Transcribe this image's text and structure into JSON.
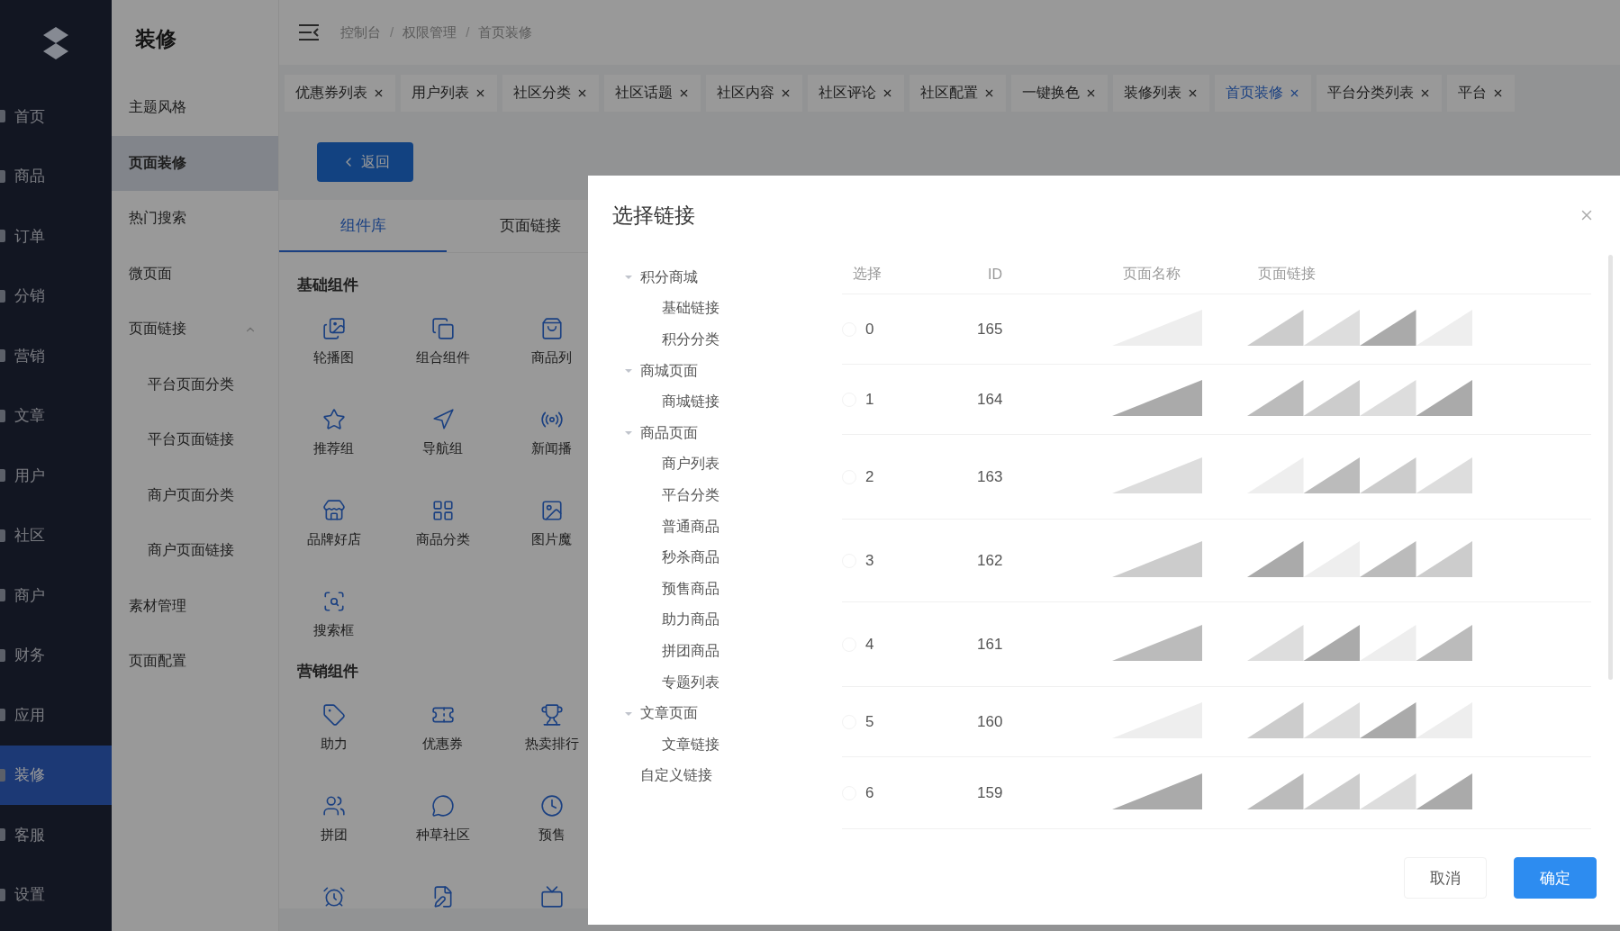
{
  "main_menu": [
    {
      "label": "首页",
      "selected": false
    },
    {
      "label": "商品",
      "selected": false
    },
    {
      "label": "订单",
      "selected": false
    },
    {
      "label": "分销",
      "selected": false
    },
    {
      "label": "营销",
      "selected": false
    },
    {
      "label": "文章",
      "selected": false
    },
    {
      "label": "用户",
      "selected": false
    },
    {
      "label": "社区",
      "selected": false
    },
    {
      "label": "商户",
      "selected": false
    },
    {
      "label": "财务",
      "selected": false
    },
    {
      "label": "应用",
      "selected": false
    },
    {
      "label": "装修",
      "selected": true
    },
    {
      "label": "客服",
      "selected": false
    },
    {
      "label": "设置",
      "selected": false
    }
  ],
  "sub_menu": {
    "title": "装修",
    "items": [
      {
        "label": "主题风格",
        "selected": false
      },
      {
        "label": "页面装修",
        "selected": true
      },
      {
        "label": "热门搜索",
        "selected": false
      },
      {
        "label": "微页面",
        "selected": false
      },
      {
        "label": "页面链接",
        "selected": false,
        "expanded": true,
        "children": [
          {
            "label": "平台页面分类",
            "selected": false
          },
          {
            "label": "平台页面链接",
            "selected": false
          },
          {
            "label": "商户页面分类",
            "selected": false
          },
          {
            "label": "商户页面链接",
            "selected": false
          }
        ]
      },
      {
        "label": "素材管理",
        "selected": false
      },
      {
        "label": "页面配置",
        "selected": false
      }
    ]
  },
  "breadcrumb": [
    "控制台",
    "权限管理",
    "首页装修"
  ],
  "breadcrumb_separator": "/",
  "page_tabs": [
    {
      "label": "优惠券列表",
      "selected": false
    },
    {
      "label": "用户列表",
      "selected": false
    },
    {
      "label": "社区分类",
      "selected": false
    },
    {
      "label": "社区话题",
      "selected": false
    },
    {
      "label": "社区内容",
      "selected": false
    },
    {
      "label": "社区评论",
      "selected": false
    },
    {
      "label": "社区配置",
      "selected": false
    },
    {
      "label": "一键换色",
      "selected": false
    },
    {
      "label": "装修列表",
      "selected": false
    },
    {
      "label": "首页装修",
      "selected": true
    },
    {
      "label": "平台分类列表",
      "selected": false
    },
    {
      "label": "平台",
      "selected": false
    }
  ],
  "back_button": "返回",
  "panel_tabs": [
    {
      "label": "组件库",
      "selected": true
    },
    {
      "label": "页面链接",
      "selected": false
    }
  ],
  "component_groups": [
    {
      "title": "基础组件",
      "items": [
        {
          "label": "轮播图"
        },
        {
          "label": "组合组件"
        },
        {
          "label": "商品列"
        },
        {
          "label": "推荐组"
        },
        {
          "label": "导航组"
        },
        {
          "label": "新闻播"
        },
        {
          "label": "品牌好店"
        },
        {
          "label": "商品分类"
        },
        {
          "label": "图片魔"
        },
        {
          "label": "搜索框"
        }
      ]
    },
    {
      "title": "营销组件",
      "items": [
        {
          "label": "助力"
        },
        {
          "label": "优惠券"
        },
        {
          "label": "热卖排行"
        },
        {
          "label": "拼团"
        },
        {
          "label": "种草社区"
        },
        {
          "label": "预售"
        },
        {
          "kind": "icon-only"
        },
        {
          "kind": "icon-only"
        },
        {
          "kind": "icon-only"
        }
      ]
    }
  ],
  "dialog": {
    "title": "选择链接",
    "tree": [
      {
        "label": "积分商城",
        "expanded": true,
        "children": [
          {
            "label": "基础链接"
          },
          {
            "label": "积分分类"
          }
        ]
      },
      {
        "label": "商城页面",
        "expanded": true,
        "children": [
          {
            "label": "商城链接"
          }
        ]
      },
      {
        "label": "商品页面",
        "expanded": true,
        "children": [
          {
            "label": "商户列表"
          },
          {
            "label": "平台分类"
          },
          {
            "label": "普通商品"
          },
          {
            "label": "秒杀商品"
          },
          {
            "label": "预售商品"
          },
          {
            "label": "助力商品"
          },
          {
            "label": "拼团商品"
          },
          {
            "label": "专题列表"
          }
        ]
      },
      {
        "label": "文章页面",
        "expanded": true,
        "children": [
          {
            "label": "文章链接"
          }
        ]
      },
      {
        "label": "自定义链接"
      }
    ],
    "table": {
      "columns": [
        "选择",
        "ID",
        "页面名称",
        "页面链接"
      ],
      "rows": [
        {
          "index": "0",
          "id": "165",
          "selected": false
        },
        {
          "index": "1",
          "id": "164",
          "selected": false
        },
        {
          "index": "2",
          "id": "163",
          "selected": false
        },
        {
          "index": "3",
          "id": "162",
          "selected": false
        },
        {
          "index": "4",
          "id": "161",
          "selected": false
        },
        {
          "index": "5",
          "id": "160",
          "selected": false
        },
        {
          "index": "6",
          "id": "159",
          "selected": false
        }
      ]
    },
    "buttons": [
      {
        "label": "取消",
        "kind": "default"
      },
      {
        "label": "确定",
        "kind": "primary"
      }
    ]
  }
}
